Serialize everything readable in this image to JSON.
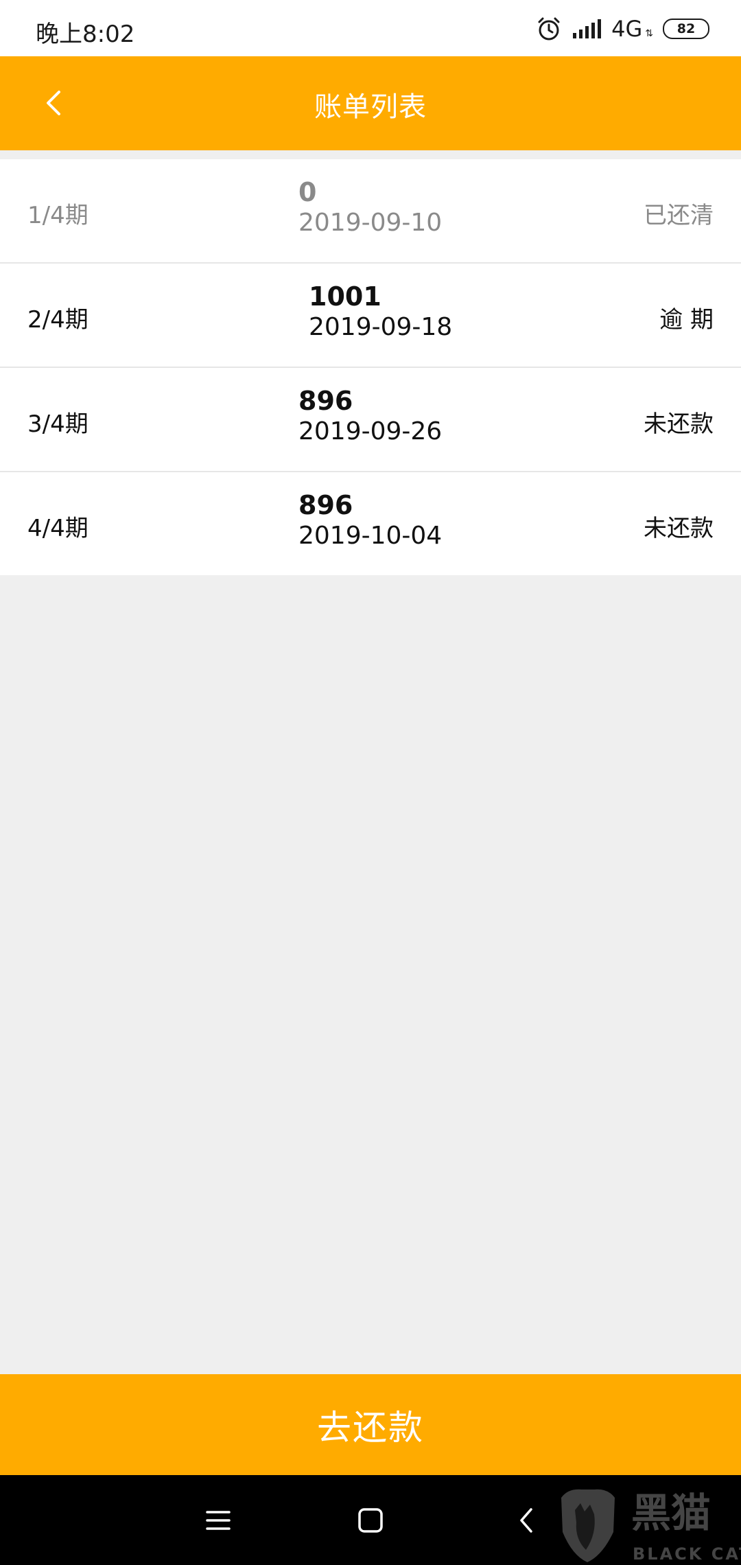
{
  "status_bar": {
    "time": "晚上8:02",
    "network": "4G",
    "battery": "82"
  },
  "header": {
    "title": "账单列表",
    "back_icon": "chevron-left-icon"
  },
  "bills": [
    {
      "period": "1/4期",
      "amount": "0",
      "date": "2019-09-10",
      "status": "已还清",
      "state": "paid"
    },
    {
      "period": "2/4期",
      "amount": "1001",
      "date": "2019-09-18",
      "status": "逾 期",
      "state": "overdue"
    },
    {
      "period": "3/4期",
      "amount": "896",
      "date": "2019-09-26",
      "status": "未还款",
      "state": "unpaid"
    },
    {
      "period": "4/4期",
      "amount": "896",
      "date": "2019-10-04",
      "status": "未还款",
      "state": "unpaid"
    }
  ],
  "footer": {
    "pay_button_label": "去还款"
  },
  "nav": {
    "menu_icon": "menu-icon",
    "home_icon": "home-icon",
    "back_icon": "back-icon"
  },
  "watermark": {
    "brand_cn": "黑猫",
    "brand_en": "BLACK CAT"
  },
  "colors": {
    "accent": "#ffab00",
    "background": "#efefef",
    "muted_text": "#8a8a8a"
  }
}
